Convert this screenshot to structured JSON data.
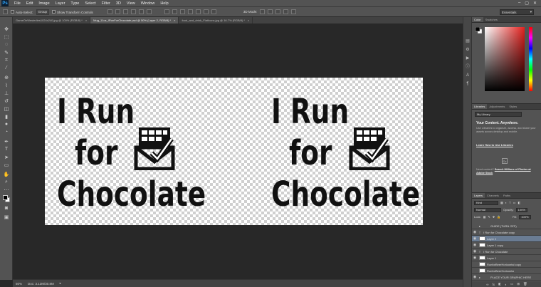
{
  "app": {
    "logo": "Ps"
  },
  "menu": [
    "File",
    "Edit",
    "Image",
    "Layer",
    "Type",
    "Select",
    "Filter",
    "3D",
    "View",
    "Window",
    "Help"
  ],
  "window_controls": [
    "–",
    "▢",
    "✕"
  ],
  "options": {
    "auto_select_label": "Auto-Select:",
    "auto_select_value": "Group",
    "show_transform_label": "Show Transform Controls",
    "mode_label": "3D Mode:",
    "workspace": "Essentials"
  },
  "tabs": [
    {
      "label": "GameOnWesterlies1024x240.jpg @ 100% (RGB/8) *",
      "active": false
    },
    {
      "label": "Mug_11oz_IRunForChocolate.psd @ 50% (Layer 2, RGB/8) *",
      "active": true
    },
    {
      "label": "food_and_drink_FlatIcons.jpg @ 16.7% (RGB/8) *",
      "active": false
    }
  ],
  "tab_close": "×",
  "artwork": {
    "left": {
      "line1": "I Run",
      "line2": "for",
      "line3": "Chocolate"
    },
    "right": {
      "line1": "I Run",
      "line2": "for",
      "line3": "Chocolate"
    }
  },
  "status": {
    "zoom": "50%",
    "doc": "Doc: 3.13M/30.8M",
    "arrow": "▸"
  },
  "color_panel": {
    "tabs": [
      "Color",
      "Swatches"
    ]
  },
  "libraries": {
    "tabs": [
      "Libraries",
      "Adjustments",
      "Styles"
    ],
    "select": "My Library",
    "title": "Your Content. Anywhere.",
    "desc": "Use Libraries to organize, access, and share your assets across desktop and mobile.",
    "link": "Learn How to Use Libraries",
    "cc": "Cc",
    "need_prefix": "Need content?",
    "need_link": "Search Millions of Photos at Adobe Stock"
  },
  "layers": {
    "tabs": [
      "Layers",
      "Channels",
      "Paths"
    ],
    "kind": "Kind",
    "blend": "Normal",
    "opacity_label": "Opacity:",
    "opacity": "100%",
    "lock_label": "Lock:",
    "fill_label": "Fill:",
    "fill": "100%",
    "items": [
      {
        "name": "GUIDE (TURN OFF)",
        "type": "▸",
        "active": false,
        "eye": ""
      },
      {
        "name": "I Run for Chocolate copy",
        "type": "T",
        "active": false,
        "eye": "◉"
      },
      {
        "name": "Layer 2",
        "type": "",
        "active": true,
        "eye": "◉"
      },
      {
        "name": "Layer 1 copy",
        "type": "",
        "active": false,
        "eye": "◉"
      },
      {
        "name": "I Run for Chocolate",
        "type": "T",
        "active": false,
        "eye": "◉"
      },
      {
        "name": "Layer 1",
        "type": "",
        "active": false,
        "eye": "◉"
      },
      {
        "name": "RunforBeerHorizontal copy",
        "type": "",
        "active": false,
        "eye": ""
      },
      {
        "name": "RunforBeerHorizontal",
        "type": "",
        "active": false,
        "eye": ""
      },
      {
        "name": "PLACE YOUR GRAPHIC HERE",
        "type": "▸",
        "active": false,
        "eye": "◉"
      }
    ],
    "footer": [
      "∞",
      "fx",
      "◧",
      "◐",
      "▭",
      "⊞",
      "🗑"
    ]
  },
  "colors": {
    "accent": "#6a7c93",
    "panel": "#535353",
    "canvas": "#282828"
  }
}
